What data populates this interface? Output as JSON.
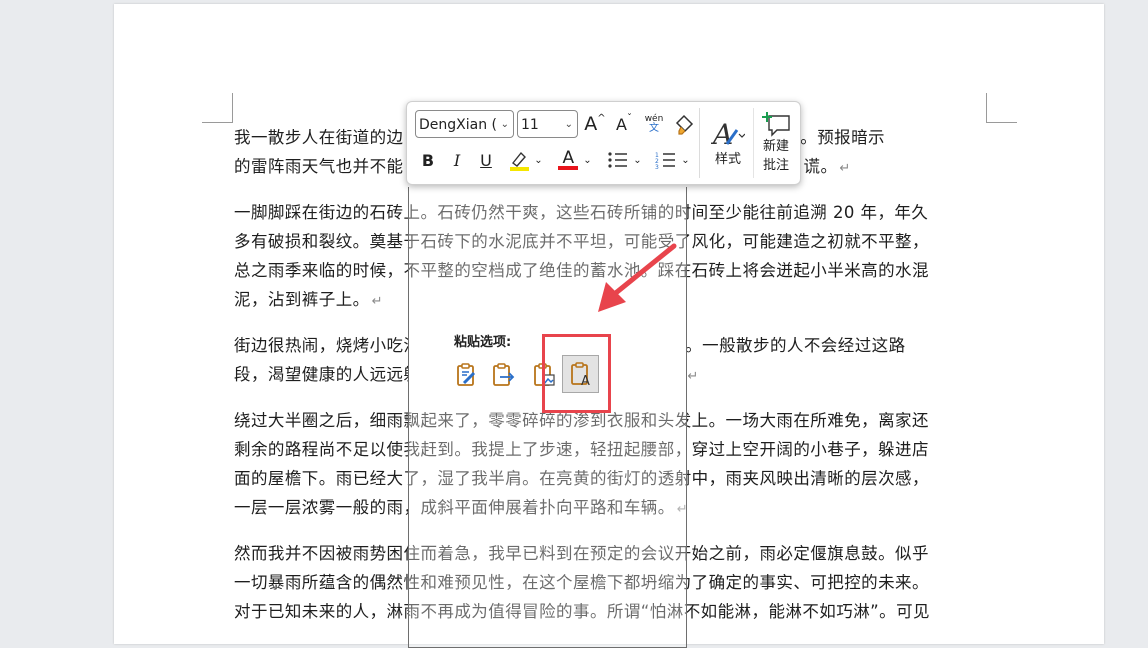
{
  "toolbar": {
    "font_name": "DengXian (",
    "font_size": "11",
    "grow_font": "A",
    "shrink_font": "A",
    "phonetic_top": "wén",
    "phonetic_bottom": "文",
    "bold": "B",
    "italic": "I",
    "underline": "U",
    "font_color_letter": "A",
    "styles_label": "样式",
    "new_comment_label_1": "新建",
    "new_comment_label_2": "批注",
    "highlight_color": "#f5e600",
    "font_color": "#e8141c"
  },
  "paste": {
    "title": "粘贴选项:"
  },
  "colors": {
    "annotation_red": "#e8444c"
  },
  "document": {
    "p1_l1": "我一散步人在街道的边",
    "p1_l1_end": "紫色的电光。预报暗示",
    "p1_l2": "的雷阵雨天气也并不能",
    "p1_l2_end": "谎。",
    "p2_l1": "一脚脚踩在街边的石砖上。石砖仍然干爽，这些石砖所铺的时间至少能往前追溯 20 年，年久",
    "p2_l2": "多有破损和裂纹。奠基于石砖下的水泥底并不平坦，可能受了风化，可能建造之初就不平整，",
    "p2_l3": "总之雨季来临的时候，不平整的空档成了绝佳的蓄水池。踩在石砖上将会迸起小半米高的水混",
    "p2_l4": "泥，沾到裤子上。",
    "p3_l1": "街边很热闹，烧烤小吃没有",
    "p3_l1_end": "闷且厚重。一般散步的人不会经过这路",
    "p3_l2": "段，渴望健康的人远远躲着",
    "p4_l1": "绕过大半圈之后，细雨飘起来了，零零碎碎的渗到衣服和头发上。一场大雨在所难免，离家还",
    "p4_l2": "剩余的路程尚不足以使我赶到。我提上了步速，轻扭起腰部，穿过上空开阔的小巷子，躲进店",
    "p4_l3": "面的屋檐下。雨已经大了，湿了我半肩。在亮黄的街灯的透射中，雨夹风映出清晰的层次感，",
    "p4_l4": "一层一层浓雾一般的雨，成斜平面伸展着扑向平路和车辆。",
    "p5_l1": "然而我并不因被雨势困住而着急，我早已料到在预定的会议开始之前，雨必定偃旗息鼓。似乎",
    "p5_l2": "一切暴雨所蕴含的偶然性和难预见性，在这个屋檐下都坍缩为了确定的事实、可把控的未来。",
    "p5_l3": "对于已知未来的人，淋雨不再成为值得冒险的事。所谓“怕淋不如能淋，能淋不如巧淋”。可见",
    "para_mark": "↵"
  }
}
